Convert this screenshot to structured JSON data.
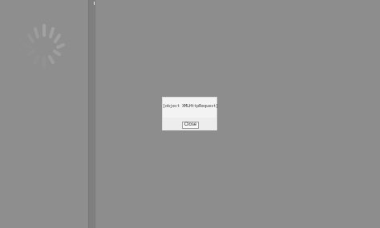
{
  "dialog": {
    "message": "[object XMLHttpRequest]",
    "close_label": "Close"
  },
  "loading": {
    "icon": "loading-spinner-icon"
  },
  "colors": {
    "overlay": "#8b8b8b",
    "dialog_background": "#f3f3f3",
    "spinner": "#a0a0a0"
  }
}
